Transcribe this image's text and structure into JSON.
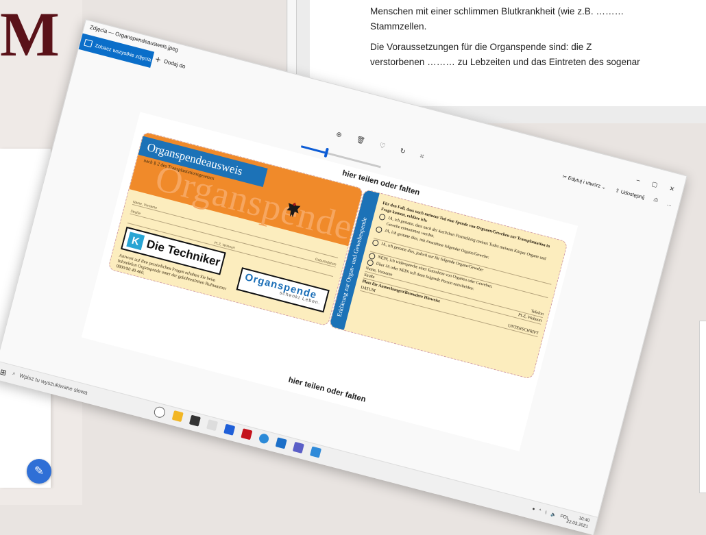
{
  "background": {
    "logo_letter": "M",
    "doc_lines": [
      "Menschen mit einer schlimmen Blutkrankheit (wie z.B. ………",
      "Stammzellen.",
      "Die Voraussetzungen für die Organspende sind: die Z",
      "verstorbenen ……… zu Lebzeiten und das Eintreten des sogenar"
    ]
  },
  "photos": {
    "window_title": "Zdjęcia — Organspendeausweis.jpeg",
    "see_all_label": "Zobacz wszystkie zdjęcia",
    "add_to_label": "Dodaj do",
    "edit_label": "Edytuj i utwórz",
    "share_label": "Udostępnij",
    "zoom_level": 0.3
  },
  "card": {
    "fold_top": "hier teilen oder falten",
    "fold_bottom": "hier teilen oder falten",
    "front_title": "Organspendeausweis",
    "front_subtitle": "nach § 2 des Transplantationsgesetzes",
    "front_big": "Organspende",
    "field_name": "Name, Vorname",
    "field_birth": "Geburtsdatum",
    "field_street": "Straße",
    "field_city": "PLZ, Wohnort",
    "tk_label": "Die Techniker",
    "os_label": "Organspende",
    "os_sub": "schenkt Leben.",
    "front_footer": "Antwort auf Ihre persönlichen Fragen erhalten Sie beim Infotelefon Organspende unter der gebührenfreien Rufnummer 0800/90 40 400.",
    "back_band": "Erklärung zur Organ- und Gewebespende",
    "back_intro": "Für den Fall, dass nach meinem Tod eine Spende von Organen/Geweben zur Transplantation in Frage kommt, erkläre ich:",
    "options": [
      "JA, ich gestatte, dass nach der ärztlichen Feststellung meines Todes meinem Körper Organe und Gewebe entnommen werden.",
      "JA, ich gestatte dies, mit Ausnahme folgender Organe/Gewebe:",
      "JA, ich gestatte dies, jedoch nur für folgende Organe/Gewebe:",
      "NEIN, ich widerspreche einer Entnahme von Organen oder Geweben.",
      "Über JA oder NEIN soll dann folgende Person entscheiden:"
    ],
    "back_name": "Name, Vorname",
    "back_phone": "Telefon",
    "back_street": "Straße",
    "back_city": "PLZ, Wohnort",
    "back_notes": "Platz für Anmerkungen/Besondere Hinweise",
    "back_date": "DATUM",
    "back_sign": "UNTERSCHRIFT"
  },
  "taskbar": {
    "search_placeholder": "Wpisz tu wyszukiwane słowa",
    "lang": "POL",
    "time": "10:40",
    "date": "22.03.2021"
  }
}
